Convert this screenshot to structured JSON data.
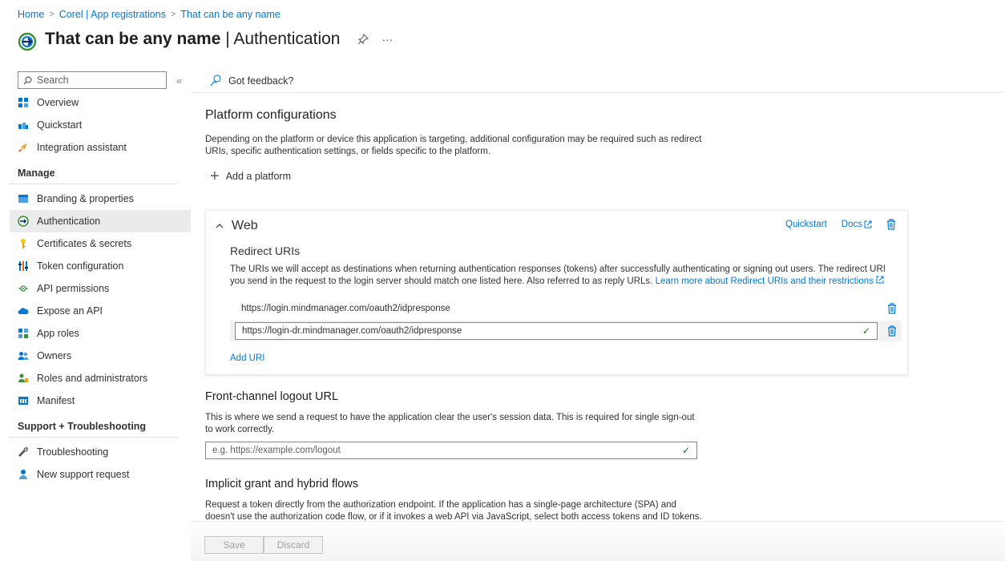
{
  "breadcrumb": {
    "home": "Home",
    "tenant": "Corel | App registrations",
    "app": "That can be any name"
  },
  "header": {
    "title_bold": "That can be any name",
    "title_rest": " | Authentication",
    "pin_icon": "pin-icon",
    "more": "···"
  },
  "sidebar": {
    "search_placeholder": "Search",
    "collapse": "«",
    "items": [
      {
        "label": "Overview",
        "icon": "grid-icon"
      },
      {
        "label": "Quickstart",
        "icon": "cloud-icon"
      },
      {
        "label": "Integration assistant",
        "icon": "rocket-icon"
      }
    ],
    "manage_label": "Manage",
    "manage_items": [
      {
        "label": "Branding & properties",
        "icon": "branding-icon"
      },
      {
        "label": "Authentication",
        "icon": "authentication-icon",
        "active": true
      },
      {
        "label": "Certificates & secrets",
        "icon": "key-icon"
      },
      {
        "label": "Token configuration",
        "icon": "token-icon"
      },
      {
        "label": "API permissions",
        "icon": "permissions-icon"
      },
      {
        "label": "Expose an API",
        "icon": "cloud-api-icon"
      },
      {
        "label": "App roles",
        "icon": "app-roles-icon"
      },
      {
        "label": "Owners",
        "icon": "owners-icon"
      },
      {
        "label": "Roles and administrators",
        "icon": "roles-icon"
      },
      {
        "label": "Manifest",
        "icon": "manifest-icon"
      }
    ],
    "support_label": "Support + Troubleshooting",
    "support_items": [
      {
        "label": "Troubleshooting",
        "icon": "wrench-icon"
      },
      {
        "label": "New support request",
        "icon": "support-person-icon"
      }
    ]
  },
  "cmdbar": {
    "feedback": "Got feedback?"
  },
  "platform": {
    "title": "Platform configurations",
    "desc": "Depending on the platform or device this application is targeting, additional configuration may be required such as redirect URIs, specific authentication settings, or fields specific to the platform.",
    "add": "Add a platform"
  },
  "web": {
    "title": "Web",
    "quickstart": "Quickstart",
    "docs": "Docs",
    "redirect_title": "Redirect URIs",
    "redirect_desc": "The URIs we will accept as destinations when returning authentication responses (tokens) after successfully authenticating or signing out users. The redirect URI you send in the request to the login server should match one listed here. Also referred to as reply URLs.",
    "learn_more": "Learn more about Redirect URIs and their restrictions",
    "uris": [
      "https://login.mindmanager.com/oauth2/idpresponse",
      "https://login-dr.mindmanager.com/oauth2/idpresponse"
    ],
    "add_uri": "Add URI"
  },
  "logout": {
    "title": "Front-channel logout URL",
    "desc": "This is where we send a request to have the application clear the user's session data. This is required for single sign-out to work correctly.",
    "placeholder": "e.g. https://example.com/logout"
  },
  "implicit": {
    "title": "Implicit grant and hybrid flows",
    "desc": "Request a token directly from the authorization endpoint. If the application has a single-page architecture (SPA) and doesn't use the authorization code flow, or if it invokes a web API via JavaScript, select both access tokens and ID tokens."
  },
  "footer": {
    "save": "Save",
    "discard": "Discard"
  }
}
